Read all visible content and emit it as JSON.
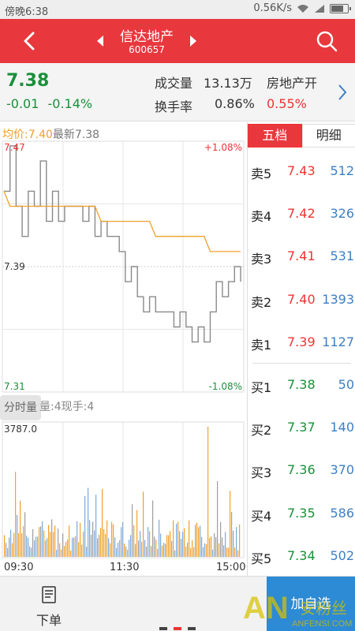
{
  "status_bar": {
    "time": "傍晚6:38",
    "speed": "0.56K/s"
  },
  "header": {
    "title": "信达地产",
    "code": "600657"
  },
  "quote": {
    "price": "7.38",
    "change": "-0.01",
    "change_pct": "-0.14%",
    "volume_label": "成交量",
    "volume_value": "13.13万",
    "sector_label": "房地产开",
    "turnover_label": "换手率",
    "turnover_value": "0.86%",
    "sector_change": "0.55%"
  },
  "chart_legend": {
    "avg": "均价:7.40",
    "last": "最新7.38"
  },
  "chart_axes": {
    "price_top": "7.47",
    "price_mid": "7.39",
    "price_bottom": "7.31",
    "pct_top": "+1.08%",
    "pct_bottom": "-1.08%",
    "times": [
      "09:30",
      "11:30",
      "15:00"
    ]
  },
  "volume_panel": {
    "button": "分时量",
    "legend": "量:4现手:4",
    "max_label": "3787.0"
  },
  "book": {
    "tabs": [
      "五档",
      "明细"
    ],
    "rows": [
      {
        "side": "卖5",
        "price": "7.43",
        "vol": "512",
        "color": "red"
      },
      {
        "side": "卖4",
        "price": "7.42",
        "vol": "326",
        "color": "red"
      },
      {
        "side": "卖3",
        "price": "7.41",
        "vol": "531",
        "color": "red"
      },
      {
        "side": "卖2",
        "price": "7.40",
        "vol": "1393",
        "color": "red"
      },
      {
        "side": "卖1",
        "price": "7.39",
        "vol": "1127",
        "color": "red"
      },
      {
        "side": "买1",
        "price": "7.38",
        "vol": "50",
        "color": "green"
      },
      {
        "side": "买2",
        "price": "7.37",
        "vol": "140",
        "color": "green"
      },
      {
        "side": "买3",
        "price": "7.36",
        "vol": "370",
        "color": "green"
      },
      {
        "side": "买4",
        "price": "7.35",
        "vol": "586",
        "color": "green"
      },
      {
        "side": "买5",
        "price": "7.34",
        "vol": "502",
        "color": "green"
      }
    ]
  },
  "bottom_bar": {
    "order_label": "下单",
    "add_label": "加自选"
  },
  "watermark": {
    "text": "ANFENSI.COM",
    "brand": "安粉丝"
  },
  "chart_data": {
    "type": "line",
    "price_range": [
      7.31,
      7.47
    ],
    "prev_close": 7.39,
    "times": [
      "09:30",
      "11:30",
      "15:00"
    ],
    "series": [
      {
        "name": "最新",
        "values": [
          7.44,
          7.47,
          7.43,
          7.41,
          7.44,
          7.43,
          7.46,
          7.42,
          7.44,
          7.42,
          7.43,
          7.43,
          7.43,
          7.42,
          7.43,
          7.41,
          7.42,
          7.41,
          7.41,
          7.4,
          7.38,
          7.39,
          7.37,
          7.36,
          7.37,
          7.36,
          7.36,
          7.36,
          7.35,
          7.36,
          7.35,
          7.34,
          7.35,
          7.34,
          7.36,
          7.38,
          7.37,
          7.38,
          7.39,
          7.38
        ]
      },
      {
        "name": "均价",
        "values": [
          7.44,
          7.43,
          7.43,
          7.43,
          7.43,
          7.43,
          7.43,
          7.43,
          7.43,
          7.43,
          7.43,
          7.43,
          7.43,
          7.43,
          7.43,
          7.43,
          7.42,
          7.42,
          7.42,
          7.42,
          7.42,
          7.42,
          7.42,
          7.42,
          7.42,
          7.41,
          7.41,
          7.41,
          7.41,
          7.41,
          7.41,
          7.41,
          7.41,
          7.41,
          7.4,
          7.4,
          7.4,
          7.4,
          7.4,
          7.4
        ]
      }
    ]
  }
}
